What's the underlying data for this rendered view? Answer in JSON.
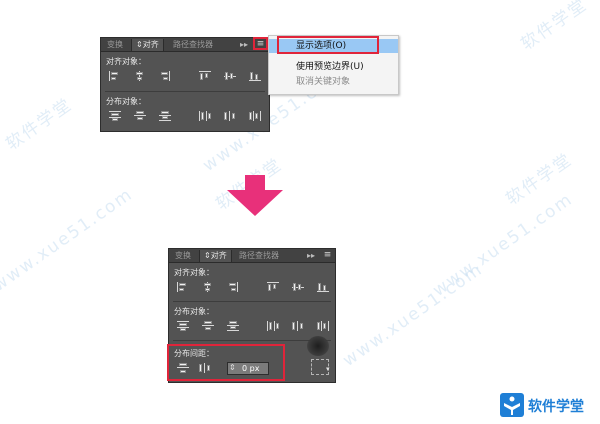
{
  "top_panel": {
    "tabs": [
      "变换",
      "对齐",
      "路径查找器"
    ],
    "active_tab_index": 1,
    "align_label": "对齐对象：",
    "distribute_label": "分布对象："
  },
  "menu": {
    "items": [
      {
        "label": "显示选项(O)",
        "highlighted": true,
        "disabled": false
      },
      {
        "label": "使用预览边界(U)",
        "highlighted": false,
        "disabled": false
      },
      {
        "label": "取消关键对象",
        "highlighted": false,
        "disabled": true
      }
    ]
  },
  "bottom_panel": {
    "tabs": [
      "变换",
      "对齐",
      "路径查找器"
    ],
    "active_tab_index": 1,
    "align_label": "对齐对象：",
    "distribute_label": "分布对象：",
    "spacing_label": "分布间距：",
    "spacing_value": "0 px"
  },
  "watermark_text": "www.xue51.com",
  "watermark_cn": "软件学堂",
  "logo_text": "软件学堂",
  "colors": {
    "panel_bg": "#535353",
    "highlight": "#99c8f4",
    "callout_red": "#e0243a",
    "arrow_pink": "#e8307a"
  }
}
